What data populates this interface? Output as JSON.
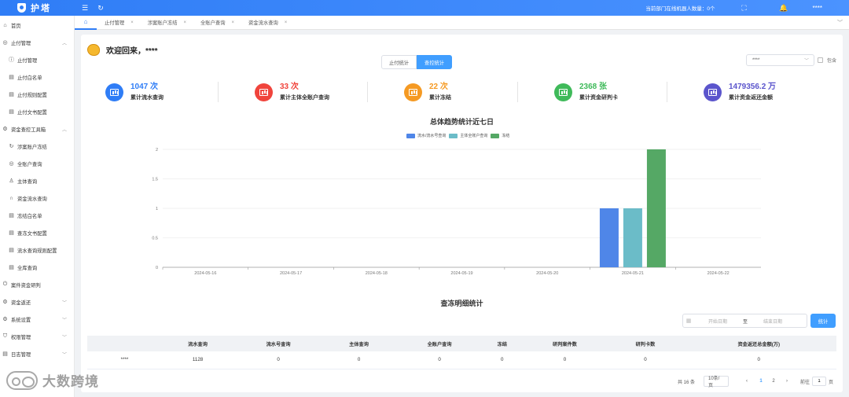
{
  "topbar": {
    "app_title": "护塔",
    "menu_icon": "menu-fold-icon",
    "refresh_icon": "refresh-icon",
    "online_text": "当前部门在线机器人数量：0个",
    "fullscreen_icon": "fullscreen-icon",
    "bell_icon": "bell-icon",
    "user_text": "****"
  },
  "sidebar": {
    "items": [
      {
        "label": "首页",
        "icon": "home-icon",
        "level": 1
      },
      {
        "label": "止付管理",
        "icon": "circle-icon",
        "level": 1,
        "expanded": true
      },
      {
        "label": "止付管理",
        "icon": "info-icon",
        "level": 2
      },
      {
        "label": "止付白名单",
        "icon": "list-icon",
        "level": 2
      },
      {
        "label": "止付规则配置",
        "icon": "list-icon",
        "level": 2
      },
      {
        "label": "止付文书配置",
        "icon": "list-icon",
        "level": 2
      },
      {
        "label": "资金查控工具箱",
        "icon": "gear-icon",
        "level": 1,
        "expanded": true
      },
      {
        "label": "涉案账户冻结",
        "icon": "refresh-icon",
        "level": 2
      },
      {
        "label": "全账户查询",
        "icon": "circle-icon",
        "level": 2
      },
      {
        "label": "主体查询",
        "icon": "user-icon",
        "level": 2
      },
      {
        "label": "资金流水查询",
        "icon": "loop-icon",
        "level": 2
      },
      {
        "label": "冻结白名单",
        "icon": "list-icon",
        "level": 2
      },
      {
        "label": "查冻文书配置",
        "icon": "list-icon",
        "level": 2
      },
      {
        "label": "流水查询规则配置",
        "icon": "list-icon",
        "level": 2
      },
      {
        "label": "全库查询",
        "icon": "list-icon",
        "level": 2
      },
      {
        "label": "案件资金研判",
        "icon": "power-icon",
        "level": 1
      },
      {
        "label": "资金返还",
        "icon": "gear-icon",
        "level": 1,
        "collapsed": true
      },
      {
        "label": "系统设置",
        "icon": "gear-icon",
        "level": 1,
        "collapsed": true
      },
      {
        "label": "权限管理",
        "icon": "shield-icon",
        "level": 1,
        "collapsed": true
      },
      {
        "label": "日志管理",
        "icon": "list-icon",
        "level": 1,
        "collapsed": true
      }
    ]
  },
  "tabs": [
    {
      "label": "止付管理"
    },
    {
      "label": "涉案账户冻结"
    },
    {
      "label": "全账户查询"
    },
    {
      "label": "资金流水查询"
    }
  ],
  "welcome": "欢迎回来，****",
  "segment": {
    "left": "止付统计",
    "right": "查控统计",
    "active": "right"
  },
  "filter": {
    "select_value": "****",
    "checkbox_label": "包含"
  },
  "stats": [
    {
      "value": "1047 次",
      "label": "累计流水查询",
      "color": "#2f7df6"
    },
    {
      "value": "33 次",
      "label": "累计主体全账户查询",
      "color": "#f0443c"
    },
    {
      "value": "22 次",
      "label": "累计冻结",
      "color": "#f59a23"
    },
    {
      "value": "2368 张",
      "label": "累计资金研判卡",
      "color": "#3fba5a"
    },
    {
      "value": "1479356.2 万",
      "label": "累计资金返还金额",
      "color": "#5b55cc"
    }
  ],
  "chart_data": {
    "type": "bar",
    "title": "总体趋势统计近七日",
    "categories": [
      "2024-05-16",
      "2024-05-17",
      "2024-05-18",
      "2024-05-19",
      "2024-05-20",
      "2024-05-21",
      "2024-05-22"
    ],
    "series": [
      {
        "name": "流水/流水号查询",
        "color": "#4f86e8",
        "values": [
          0,
          0,
          0,
          0,
          0,
          1,
          0
        ]
      },
      {
        "name": "主体全账户查询",
        "color": "#6bbcc8",
        "values": [
          0,
          0,
          0,
          0,
          0,
          1,
          0
        ]
      },
      {
        "name": "冻结",
        "color": "#55a865",
        "values": [
          0,
          0,
          0,
          0,
          0,
          2,
          0
        ]
      }
    ],
    "ylim": [
      0,
      2
    ],
    "yticks": [
      "0",
      "0.5",
      "1",
      "1.5",
      "2"
    ],
    "grid": true,
    "legend": "top-center"
  },
  "detail": {
    "title": "查冻明细统计",
    "start_placeholder": "开始日期",
    "separator": "至",
    "end_placeholder": "结束日期",
    "button": "统计",
    "columns": [
      "",
      "流水查询",
      "流水号查询",
      "主体查询",
      "全账户查询",
      "冻结",
      "研判案件数",
      "研判卡数",
      "资金返还总金额(万)"
    ],
    "rows": [
      [
        "****",
        "1128",
        "0",
        "0",
        "0",
        "0",
        "0",
        "0",
        "0"
      ]
    ]
  },
  "pager": {
    "total": "共 16 条",
    "size": "10条/页",
    "pages": [
      "1",
      "2"
    ],
    "goto_label": "前往",
    "goto_value": "1",
    "page_suffix": "页"
  },
  "watermark": "大数跨境"
}
